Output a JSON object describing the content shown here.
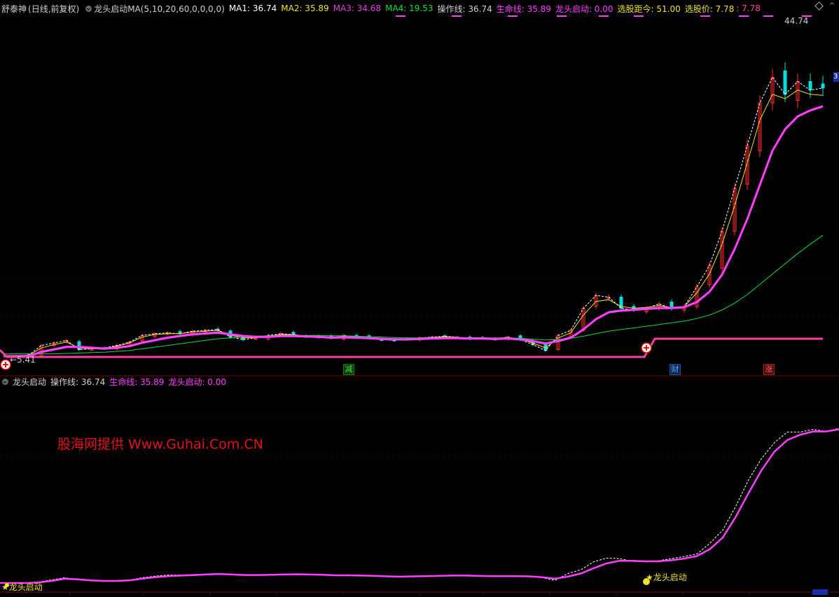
{
  "top_header": {
    "stock_name": "舒泰神",
    "period": "(日线,前复权)",
    "indicator_name": "龙头启动MA(5,10,20,60,0,0,0,0)",
    "ma1": "MA1: 36.74",
    "ma2": "MA2: 35.89",
    "ma3": "MA3: 34.68",
    "ma4": "MA4: 19.53",
    "op_line": "操作线: 36.74",
    "life_line": "生命线: 35.89",
    "dragon_start": "龙头启动: 0.00",
    "select_dist": "选股距今: 51.00",
    "select_price_label": "选股价: 7.78",
    "select_price_value": ": 7.78"
  },
  "bottom_header": {
    "indicator_name": "龙头启动",
    "op_line": "操作线: 36.74",
    "life_line": "生命线: 35.89",
    "dragon_start": "龙头启动: 0.00"
  },
  "annotations": {
    "high_price": "44.74",
    "low_price": "←5.41",
    "event_jian": "减",
    "event_cai": "财",
    "event_zhang": "涨",
    "signal_label_left": "★龙头启动",
    "signal_label_right": "★龙头启动",
    "right_edge_tag": "3"
  },
  "watermark": "股海网提供 Www.Guhai.Com.CN",
  "colors": {
    "background": "#000000",
    "ma1": "#ffffff",
    "ma2": "#f0e030",
    "ma3": "#e040e0",
    "ma4": "#00e040",
    "op_line": "#ff40ff",
    "life_line": "#ff3fa0",
    "up_candle": "#ff3030",
    "down_candle": "#00e0e0",
    "grid": "#3a0000"
  },
  "chart_data": [
    {
      "type": "candlestick",
      "title": "",
      "ylim": [
        4.5,
        47
      ],
      "series": [
        {
          "name": "MA1",
          "values": [
            5.4,
            5.4,
            5.45,
            6.6,
            6.9,
            7.2,
            6.1,
            6.2,
            6.3,
            6.6,
            7.0,
            7.8,
            8.0,
            8.1,
            8.0,
            8.3,
            8.4,
            8.5,
            7.6,
            7.3,
            7.5,
            7.8,
            8.0,
            7.9,
            7.7,
            7.6,
            7.5,
            7.8,
            7.6,
            7.5,
            7.3,
            7.2,
            7.4,
            7.5,
            7.6,
            7.7,
            7.6,
            7.4,
            7.5,
            7.4,
            7.6,
            7.3,
            6.7,
            6.0,
            7.8,
            8.4,
            11.0,
            12.5,
            12.3,
            11.0,
            10.8,
            11.0,
            11.5,
            11.0,
            11.2,
            13.5,
            16.0,
            20.0,
            25.0,
            30.0,
            35.0,
            38.0,
            36.0,
            37.5,
            36.5,
            36.74
          ]
        },
        {
          "name": "MA2",
          "values": [
            5.4,
            5.4,
            5.4,
            6.3,
            6.7,
            7.0,
            6.3,
            6.2,
            6.25,
            6.5,
            6.9,
            7.6,
            7.9,
            8.0,
            8.0,
            8.2,
            8.3,
            8.4,
            7.8,
            7.5,
            7.5,
            7.7,
            7.9,
            7.9,
            7.7,
            7.6,
            7.55,
            7.7,
            7.6,
            7.5,
            7.35,
            7.3,
            7.4,
            7.5,
            7.55,
            7.65,
            7.6,
            7.45,
            7.5,
            7.45,
            7.55,
            7.35,
            6.9,
            6.3,
            7.5,
            8.1,
            10.2,
            11.8,
            12.0,
            11.2,
            11.0,
            11.1,
            11.3,
            11.1,
            11.2,
            12.8,
            15.0,
            18.5,
            23.0,
            28.0,
            33.0,
            36.0,
            35.5,
            36.5,
            36.0,
            35.89
          ]
        },
        {
          "name": "MA3",
          "values": [
            5.4,
            5.4,
            5.4,
            5.9,
            6.2,
            6.5,
            6.5,
            6.4,
            6.3,
            6.4,
            6.6,
            7.0,
            7.3,
            7.6,
            7.8,
            8.0,
            8.1,
            8.2,
            8.0,
            7.8,
            7.7,
            7.7,
            7.8,
            7.8,
            7.75,
            7.7,
            7.6,
            7.65,
            7.6,
            7.55,
            7.45,
            7.4,
            7.4,
            7.45,
            7.5,
            7.55,
            7.55,
            7.5,
            7.5,
            7.45,
            7.5,
            7.4,
            7.2,
            6.9,
            7.2,
            7.6,
            8.6,
            9.8,
            10.6,
            10.8,
            10.9,
            11.0,
            11.1,
            11.1,
            11.2,
            11.8,
            13.0,
            15.0,
            18.0,
            21.5,
            25.5,
            29.5,
            32.0,
            33.5,
            34.2,
            34.68
          ]
        },
        {
          "name": "MA4",
          "values": [
            5.6,
            5.6,
            5.6,
            5.6,
            5.6,
            5.65,
            5.7,
            5.75,
            5.8,
            5.9,
            6.0,
            6.2,
            6.4,
            6.6,
            6.8,
            7.0,
            7.2,
            7.4,
            7.5,
            7.6,
            7.7,
            7.75,
            7.8,
            7.8,
            7.8,
            7.8,
            7.75,
            7.75,
            7.7,
            7.65,
            7.6,
            7.55,
            7.5,
            7.5,
            7.5,
            7.5,
            7.5,
            7.5,
            7.5,
            7.5,
            7.5,
            7.45,
            7.35,
            7.25,
            7.3,
            7.45,
            7.7,
            8.0,
            8.3,
            8.5,
            8.7,
            8.9,
            9.1,
            9.3,
            9.5,
            9.8,
            10.2,
            10.8,
            11.6,
            12.6,
            13.8,
            15.0,
            16.2,
            17.4,
            18.5,
            19.53
          ]
        }
      ]
    },
    {
      "type": "line",
      "title": "",
      "series": [
        {
          "name": "操作线",
          "values": [
            1,
            1,
            1,
            1.2,
            1.6,
            2.0,
            1.6,
            1.5,
            1.4,
            1.4,
            1.5,
            2.0,
            2.3,
            2.5,
            2.5,
            2.6,
            2.7,
            2.8,
            2.6,
            2.5,
            2.5,
            2.6,
            2.7,
            2.7,
            2.6,
            2.5,
            2.4,
            2.5,
            2.4,
            2.3,
            2.2,
            2.2,
            2.3,
            2.3,
            2.4,
            2.4,
            2.4,
            2.3,
            2.3,
            2.3,
            2.3,
            2.2,
            2.0,
            1.5,
            2.8,
            3.5,
            5.0,
            5.7,
            5.6,
            5.1,
            5.0,
            5.2,
            5.6,
            6.0,
            6.5,
            8.5,
            11.0,
            15.5,
            20.5,
            24.5,
            27.5,
            29.5,
            29.5,
            30.0,
            29.6,
            30.2
          ]
        },
        {
          "name": "生命线",
          "values": [
            1,
            1,
            1,
            1.1,
            1.4,
            1.8,
            1.7,
            1.5,
            1.4,
            1.4,
            1.5,
            1.8,
            2.1,
            2.3,
            2.4,
            2.5,
            2.6,
            2.7,
            2.6,
            2.5,
            2.5,
            2.55,
            2.6,
            2.65,
            2.6,
            2.55,
            2.45,
            2.45,
            2.4,
            2.35,
            2.25,
            2.2,
            2.25,
            2.3,
            2.35,
            2.4,
            2.4,
            2.35,
            2.3,
            2.3,
            2.3,
            2.25,
            2.1,
            1.8,
            2.2,
            2.8,
            3.8,
            4.7,
            5.2,
            5.2,
            5.1,
            5.1,
            5.3,
            5.6,
            6.1,
            7.4,
            9.6,
            13.5,
            18.0,
            22.3,
            25.8,
            28.0,
            29.0,
            29.6,
            29.6,
            30.0
          ]
        }
      ]
    }
  ]
}
